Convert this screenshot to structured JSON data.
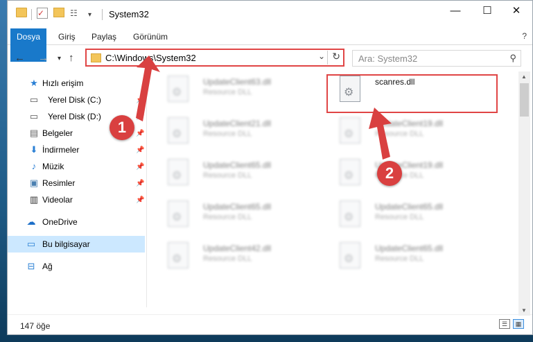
{
  "window": {
    "title": "System32",
    "controls": {
      "minimize": "—",
      "maximize": "☐",
      "close": "✕"
    }
  },
  "ribbon": {
    "tabs": [
      "Dosya",
      "Giriş",
      "Paylaş",
      "Görünüm"
    ],
    "help": "?"
  },
  "address": {
    "path": "C:\\Windows\\System32",
    "search_placeholder": "Ara: System32"
  },
  "sidebar": {
    "items": [
      {
        "label": "Hızlı erişim",
        "icon": "star-icon"
      },
      {
        "label": "Yerel Disk (C:)",
        "icon": "drive-icon",
        "pinned": true
      },
      {
        "label": "Yerel Disk (D:)",
        "icon": "drive-icon",
        "pinned": true
      },
      {
        "label": "Belgeler",
        "icon": "documents-icon",
        "pinned": true
      },
      {
        "label": "İndirmeler",
        "icon": "download-icon",
        "pinned": true
      },
      {
        "label": "Müzik",
        "icon": "music-icon",
        "pinned": true
      },
      {
        "label": "Resimler",
        "icon": "pictures-icon",
        "pinned": true
      },
      {
        "label": "Videolar",
        "icon": "videos-icon",
        "pinned": true
      },
      {
        "label": "OneDrive",
        "icon": "cloud-icon"
      },
      {
        "label": "Bu bilgisayar",
        "icon": "computer-icon",
        "selected": true
      },
      {
        "label": "Ağ",
        "icon": "network-icon"
      }
    ]
  },
  "files": {
    "left": [
      {
        "name": "UpdateClient63.dll",
        "type": "Resource DLL"
      },
      {
        "name": "UpdateClient21.dll",
        "type": "Resource DLL"
      },
      {
        "name": "UpdateClient65.dll",
        "type": "Resource DLL"
      },
      {
        "name": "UpdateClient65.dll",
        "type": "Resource DLL"
      },
      {
        "name": "UpdateClient42.dll",
        "type": "Resource DLL"
      }
    ],
    "right": [
      {
        "name": "scanres.dll",
        "type": ""
      },
      {
        "name": "UpdateClient19.dll",
        "type": "Resource DLL"
      },
      {
        "name": "UpdateClient19.dll",
        "type": "Resource DLL"
      },
      {
        "name": "UpdateClient65.dll",
        "type": "Resource DLL"
      },
      {
        "name": "UpdateClient65.dll",
        "type": "Resource DLL"
      }
    ]
  },
  "status": {
    "count": "147 öğe"
  },
  "annotations": {
    "step1": "1",
    "step2": "2",
    "color": "#d94040"
  }
}
